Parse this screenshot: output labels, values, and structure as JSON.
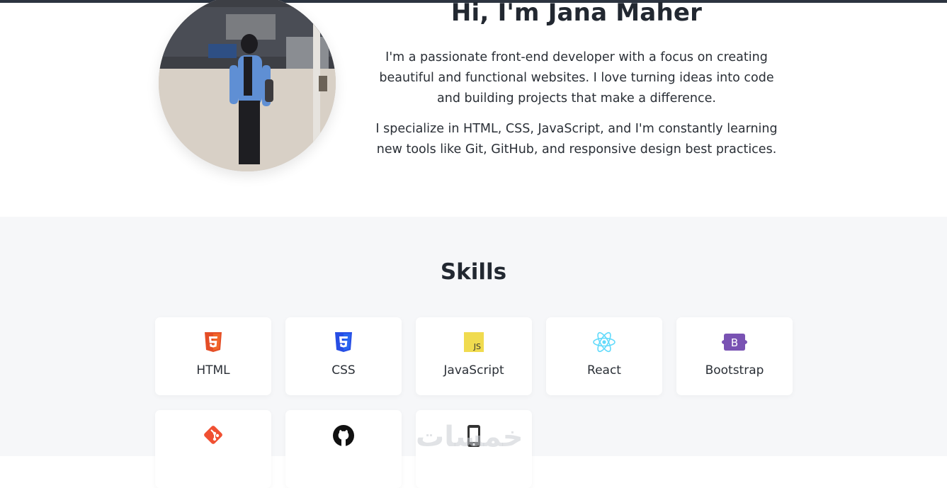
{
  "about": {
    "title": "Hi, I'm Jana Maher",
    "paragraph1": "I'm a passionate front-end developer with a focus on creating beautiful and functional websites. I love turning ideas into code and building projects that make a difference.",
    "paragraph2": "I specialize in HTML, CSS, JavaScript, and I'm constantly learning new tools like Git, GitHub, and responsive design best practices."
  },
  "skills": {
    "title": "Skills",
    "items": [
      {
        "label": "HTML",
        "icon": "html5-icon",
        "color": "#e44d26"
      },
      {
        "label": "CSS",
        "icon": "css3-icon",
        "color": "#264de4"
      },
      {
        "label": "JavaScript",
        "icon": "javascript-icon",
        "color": "#f0db4f"
      },
      {
        "label": "React",
        "icon": "react-icon",
        "color": "#61dafb"
      },
      {
        "label": "Bootstrap",
        "icon": "bootstrap-icon",
        "color": "#7952b3"
      },
      {
        "label": "",
        "icon": "git-icon",
        "color": "#f05032"
      },
      {
        "label": "",
        "icon": "github-icon",
        "color": "#111111"
      },
      {
        "label": "",
        "icon": "mobile-icon",
        "color": "#333333"
      }
    ]
  },
  "watermark": {
    "text": "خمسات"
  }
}
